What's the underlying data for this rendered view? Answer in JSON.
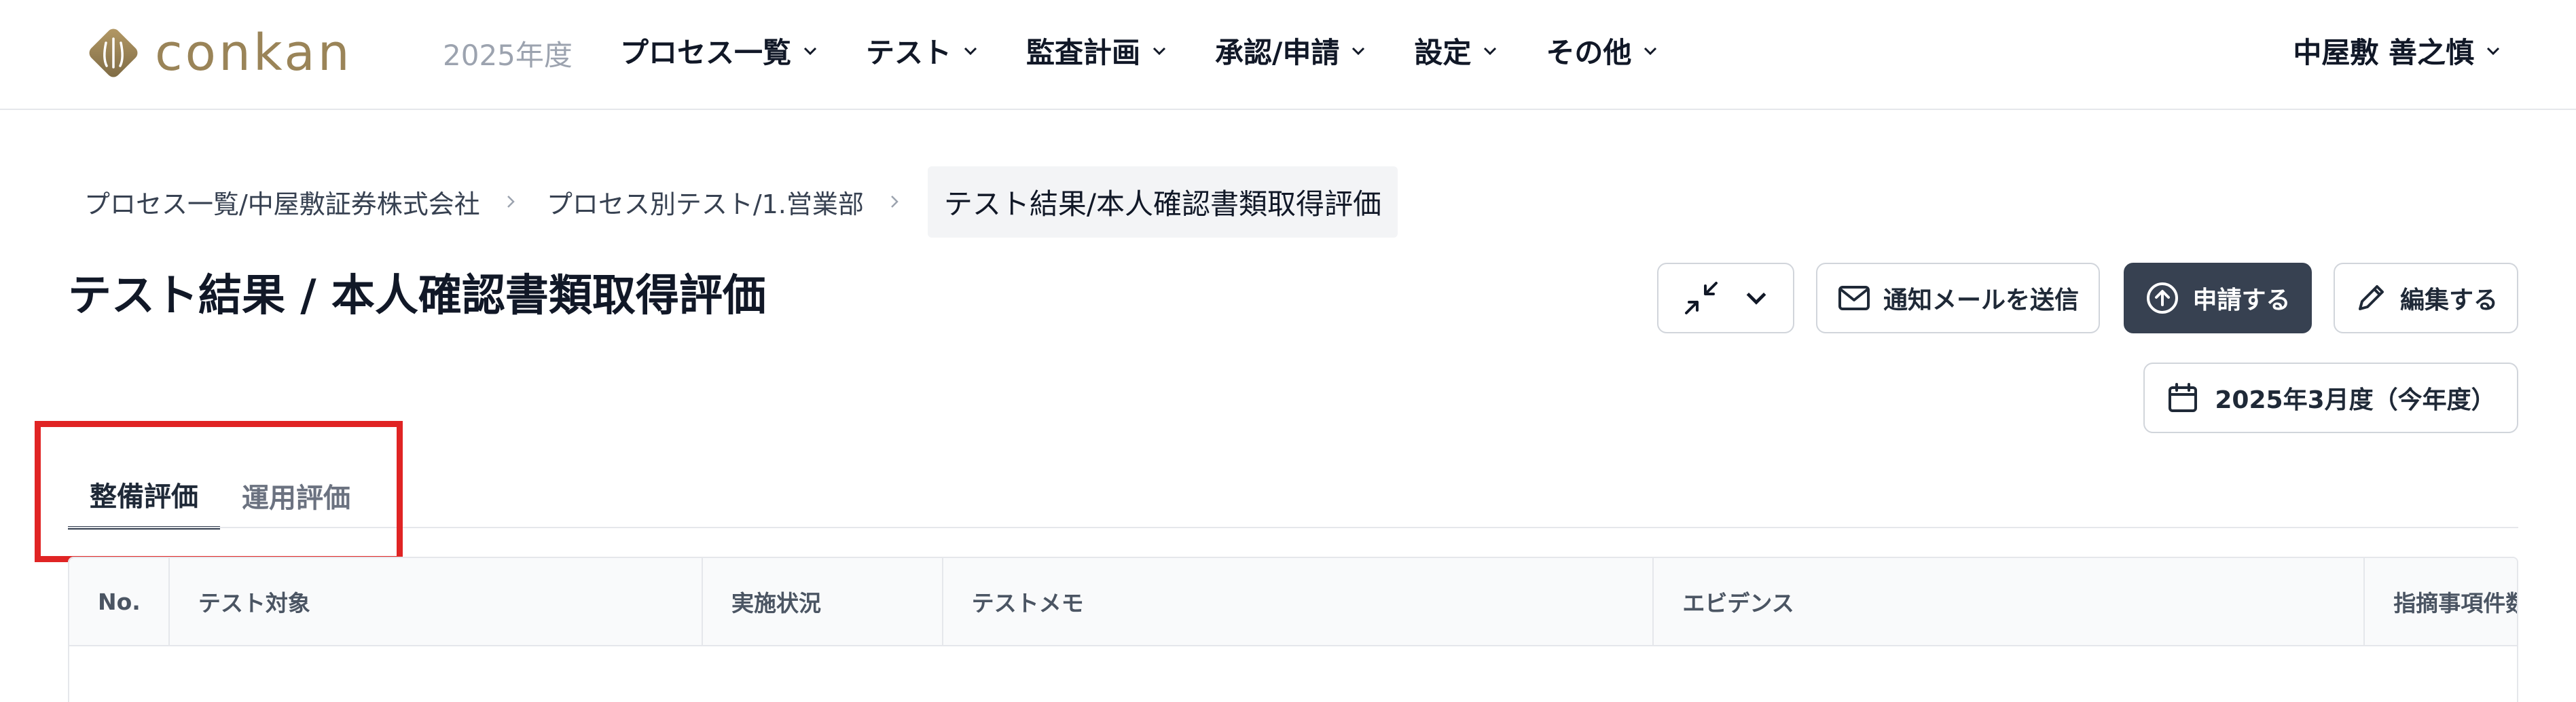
{
  "header": {
    "logo_text": "conkan",
    "fiscal_year": "2025年度",
    "nav": [
      {
        "label": "プロセス一覧"
      },
      {
        "label": "テスト"
      },
      {
        "label": "監査計画"
      },
      {
        "label": "承認/申請"
      },
      {
        "label": "設定"
      },
      {
        "label": "その他"
      }
    ],
    "user_name": "中屋敷 善之慎"
  },
  "breadcrumb": {
    "items": [
      "プロセス一覧/中屋敷証券株式会社",
      "プロセス別テスト/1.営業部"
    ],
    "current": "テスト結果/本人確認書類取得評価"
  },
  "page": {
    "title": "テスト結果 / 本人確認書類取得評価"
  },
  "actions": {
    "notify_label": "通知メールを送信",
    "apply_label": "申請する",
    "edit_label": "編集する",
    "period_label": "2025年3月度（今年度）"
  },
  "tabs": [
    {
      "label": "整備評価",
      "active": true
    },
    {
      "label": "運用評価",
      "active": false
    }
  ],
  "table": {
    "columns": [
      "No.",
      "テスト対象",
      "実施状況",
      "テストメモ",
      "エビデンス",
      "指摘事項件数"
    ]
  },
  "colors": {
    "brand": "#9a8458",
    "primary_button": "#374151",
    "highlight": "#e02424"
  }
}
